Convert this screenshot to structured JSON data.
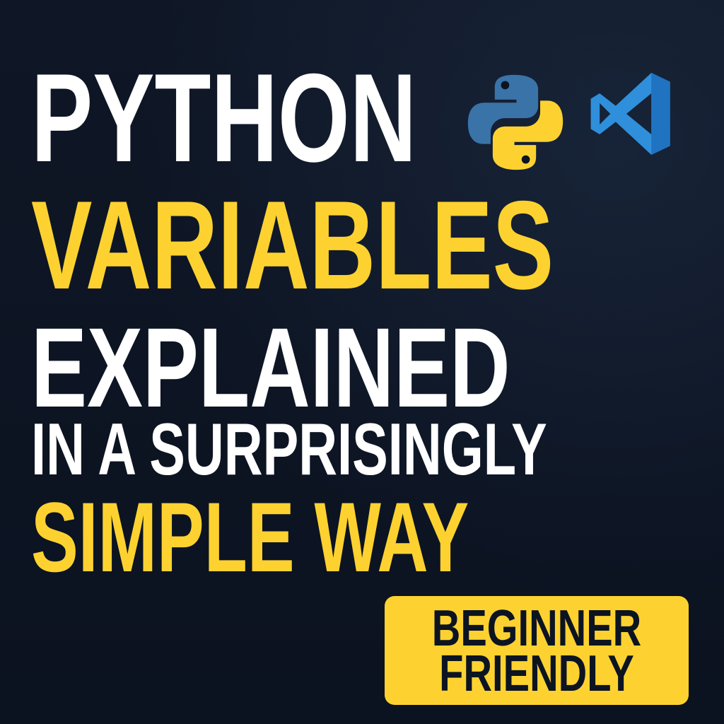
{
  "headline": {
    "line1": "PYTHON",
    "line2": "VARIABLES",
    "line3": "EXPLAINED",
    "line4": "IN A SURPRISINGLY",
    "line5": "SIMPLE WAY"
  },
  "badge": {
    "line1": "BEGINNER",
    "line2": "FRIENDLY"
  },
  "icons": {
    "python": "python-logo-icon",
    "vscode": "vscode-logo-icon"
  },
  "colors": {
    "background": "#0c1422",
    "white_text": "#ffffff",
    "accent_yellow": "#fdd230",
    "python_blue": "#3a73a8",
    "python_yellow": "#fdd230",
    "vscode_blue": "#2f8fdb"
  }
}
